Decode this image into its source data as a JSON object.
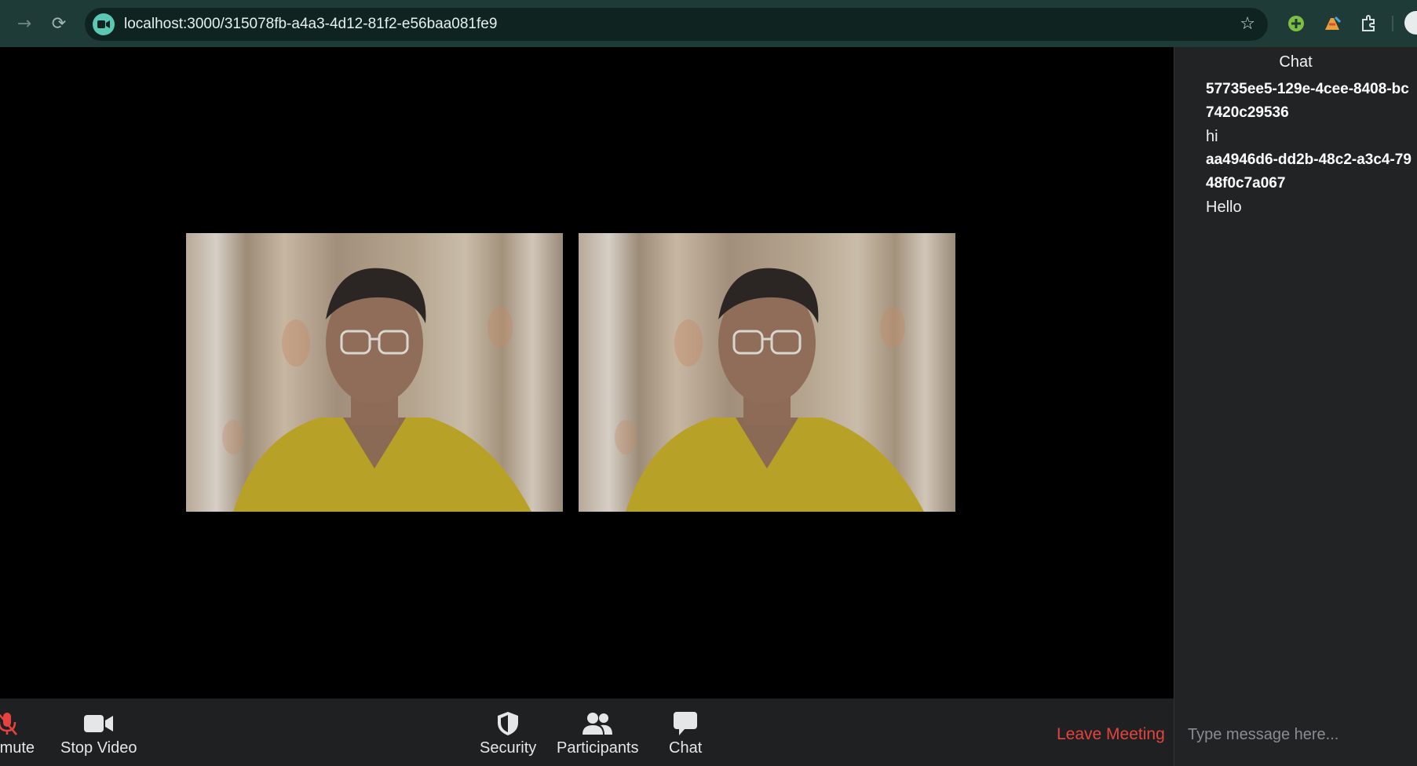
{
  "browser": {
    "url": "localhost:3000/315078fb-a4a3-4d12-81f2-e56baa081fe9",
    "site_icon": "video-camera-icon",
    "accent": "#5bc8b4"
  },
  "video": {
    "tiles": [
      {
        "label": "participant-video-1"
      },
      {
        "label": "participant-video-2"
      }
    ]
  },
  "controls": {
    "mute_label": "Unmute",
    "video_label": "Stop Video",
    "security_label": "Security",
    "participants_label": "Participants",
    "chat_label": "Chat",
    "leave_label": "Leave Meeting",
    "leave_color": "#e5443e"
  },
  "chat": {
    "title": "Chat",
    "messages": [
      {
        "sender": "57735ee5-129e-4cee-8408-bc7420c29536",
        "text": "hi"
      },
      {
        "sender": "aa4946d6-dd2b-48c2-a3c4-7948f0c7a067",
        "text": "Hello"
      }
    ],
    "input_placeholder": "Type message here..."
  }
}
